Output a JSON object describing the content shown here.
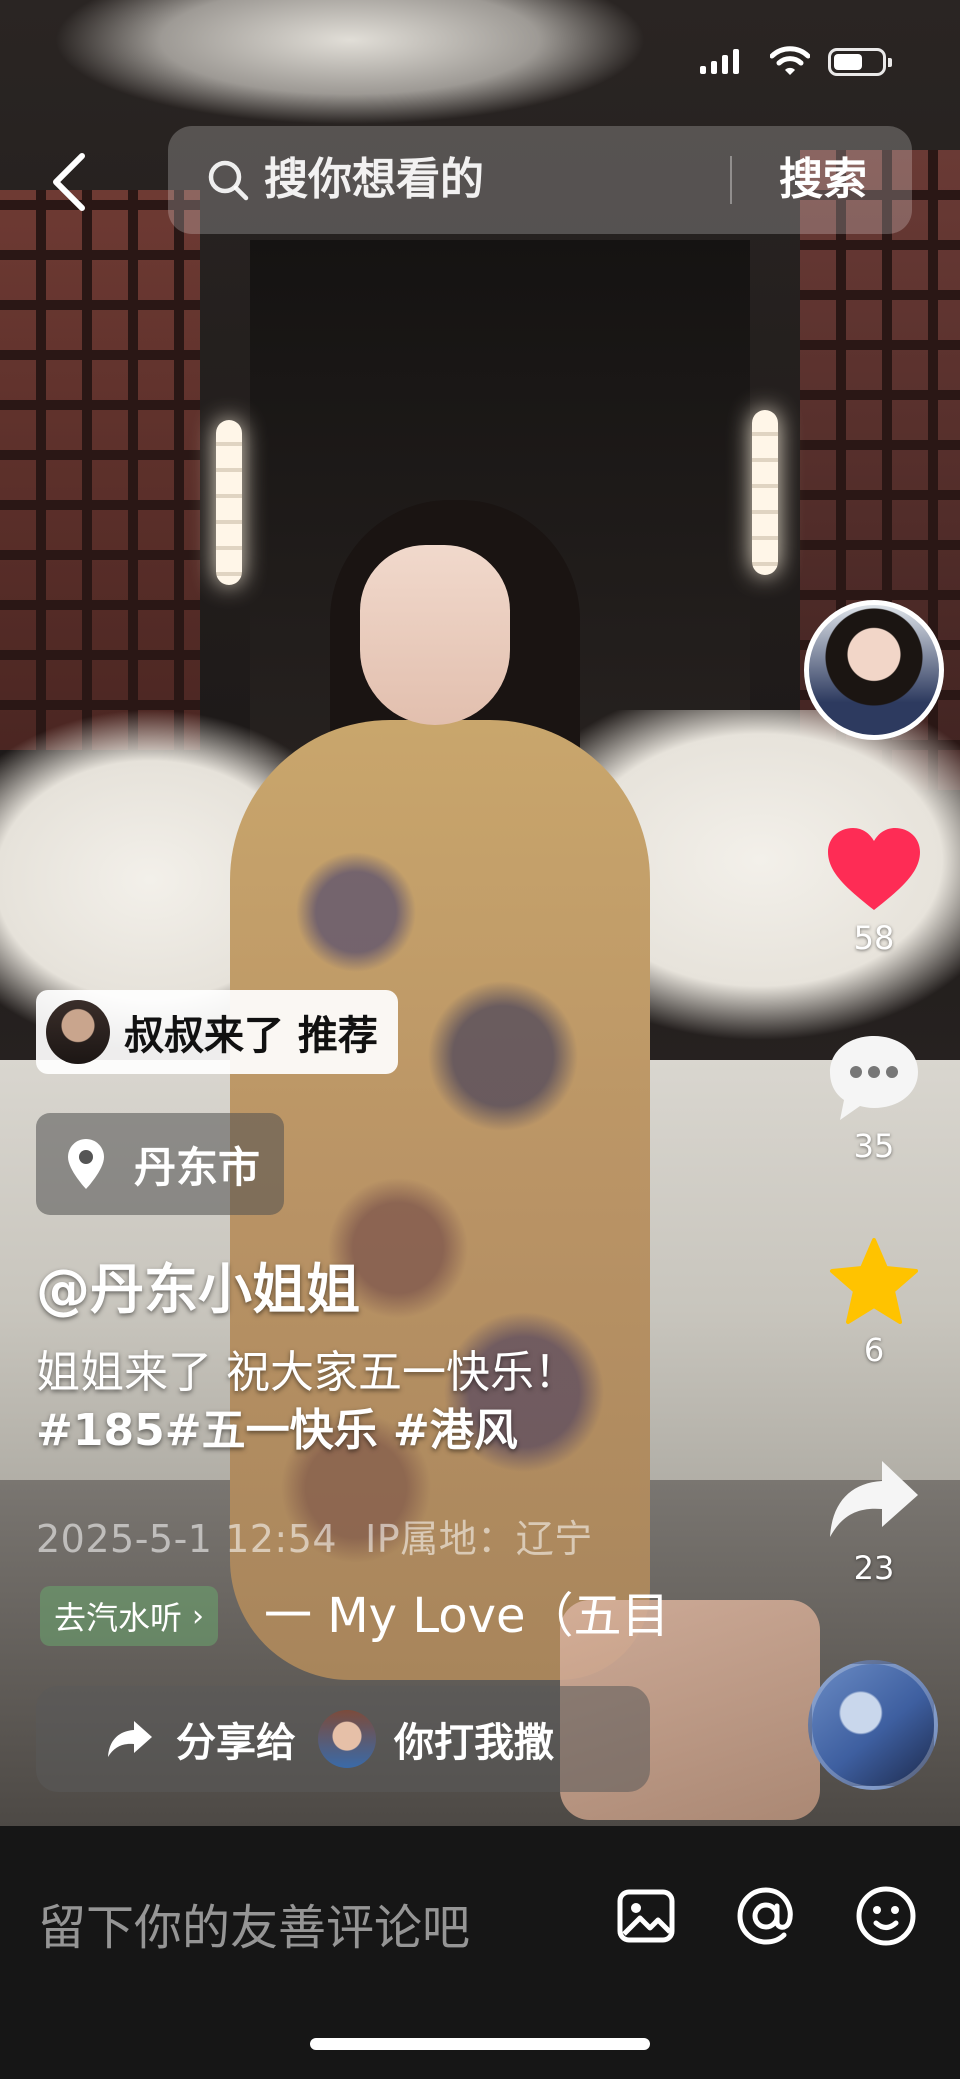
{
  "status_bar": {
    "battery_level": 0.6
  },
  "search": {
    "placeholder": "搜你想看的",
    "button_label": "搜索"
  },
  "actions": {
    "like_count": "58",
    "comment_count": "35",
    "favorite_count": "6",
    "share_count": "23",
    "like_color": "#fe2c55",
    "favorite_color": "#ffc300"
  },
  "recommend": {
    "label": "叔叔来了 推荐"
  },
  "location": {
    "city": "丹东市"
  },
  "post": {
    "author": "@丹东小姐姐",
    "caption": "姐姐来了 祝大家五一快乐！",
    "tags": "#185#五一快乐 #港风",
    "datetime": "2025-5-1 12:54",
    "ip_location": "IP属地：辽宁"
  },
  "music": {
    "chip_label": "去汽水听",
    "title": "一 My Love（五目"
  },
  "share": {
    "label": "分享给",
    "friend_name": "你打我撒"
  },
  "comment": {
    "placeholder": "留下你的友善评论吧"
  }
}
